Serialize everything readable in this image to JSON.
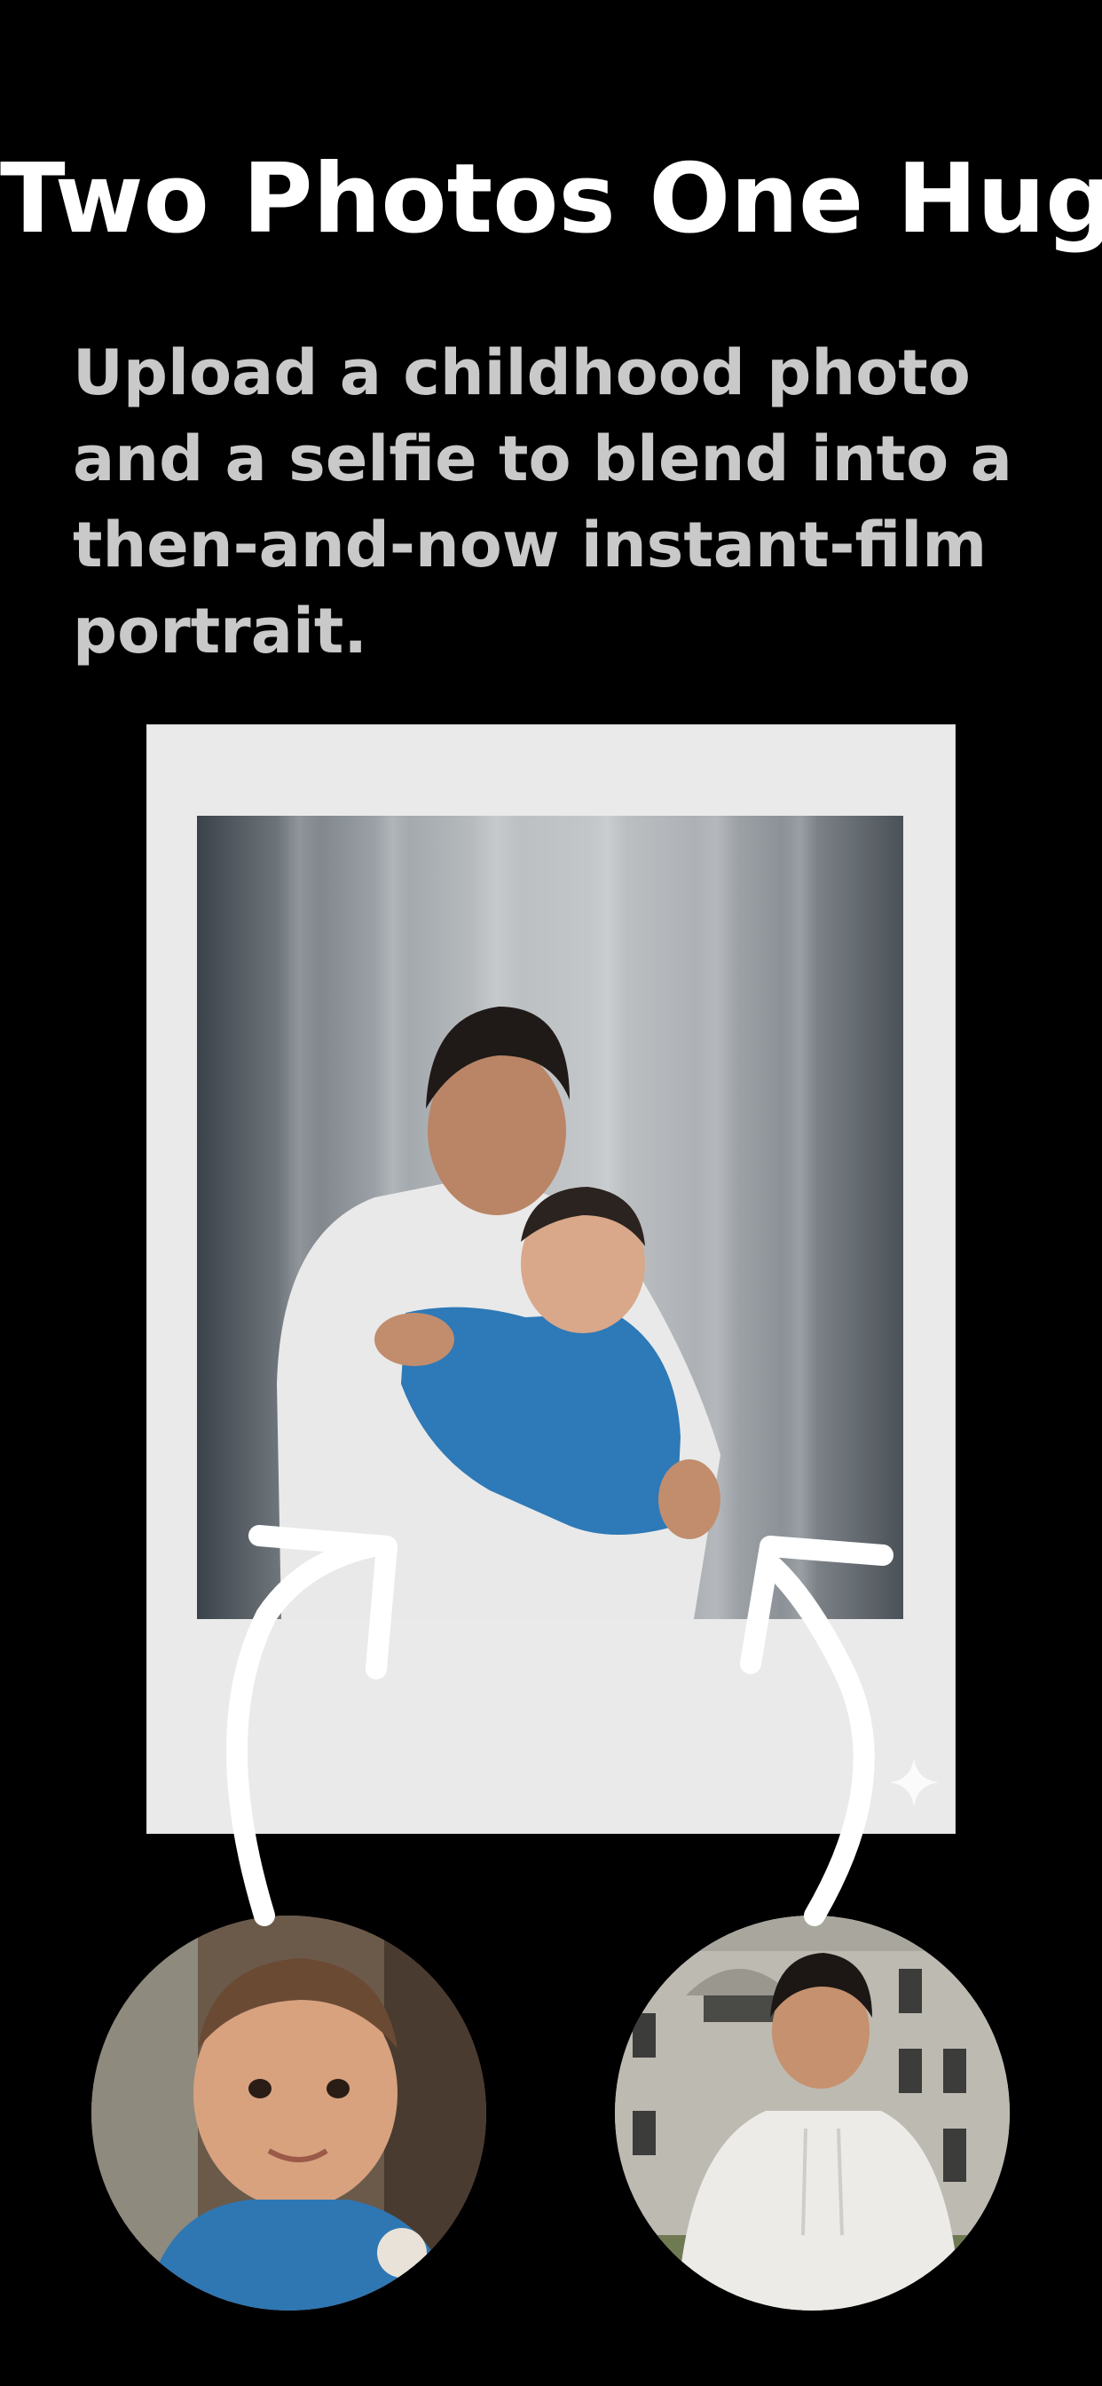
{
  "title": "Two Photos One Hug",
  "subtitle": "Upload a childhood photo and a selfie to blend into a then-and-now instant-film portrait.",
  "colors": {
    "background": "#000000",
    "title": "#ffffff",
    "subtitle": "#c9c9c9",
    "polaroid_frame": "#eaeaea",
    "arrow": "#ffffff"
  },
  "icons": {
    "sparkle": "sparkle-icon"
  }
}
